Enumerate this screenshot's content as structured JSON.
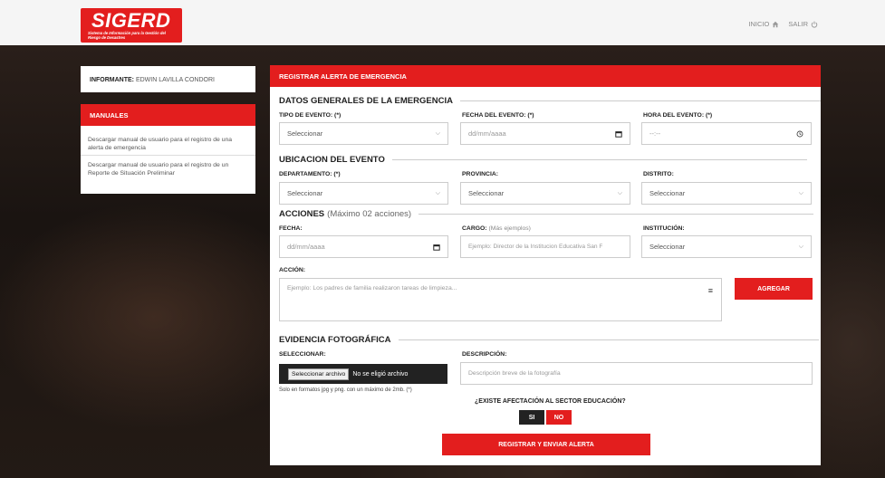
{
  "header": {
    "logo_text": "SIGERD",
    "logo_tagline": "Sistema de Información para la Gestión del Riesgo de Desastres",
    "nav": [
      {
        "label": "INICIO",
        "icon": "home-icon"
      },
      {
        "label": "SALIR",
        "icon": "power-icon"
      }
    ]
  },
  "sidebar": {
    "informante_label": "INFORMANTE:",
    "informante_name": "EDWIN LAVILLA CONDORI",
    "manuales_title": "MANUALES",
    "links": [
      "Descargar manual de usuario para el registro de una alerta de emergencia",
      "Descargar manual de usuario para el registro de un Reporte de Situación Preliminar"
    ]
  },
  "form": {
    "title": "REGISTRAR ALERTA DE EMERGENCIA",
    "section_general": "DATOS GENERALES DE LA EMERGENCIA",
    "tipo_label": "TIPO DE EVENTO: (*)",
    "tipo_value": "Seleccionar",
    "fecha_evento_label": "FECHA DEL EVENTO: (*)",
    "fecha_evento_placeholder": "dd/mm/aaaa",
    "hora_label": "HORA DEL EVENTO: (*)",
    "hora_placeholder": "--:--",
    "section_ubicacion": "UBICACION DEL EVENTO",
    "departamento_label": "DEPARTAMENTO: (*)",
    "departamento_value": "Seleccionar",
    "provincia_label": "PROVINCIA:",
    "provincia_value": "Seleccionar",
    "distrito_label": "DISTRITO:",
    "distrito_value": "Seleccionar",
    "section_acciones": "ACCIONES",
    "section_acciones_hint": "(Máximo 02 acciones)",
    "fecha_label": "FECHA:",
    "fecha_placeholder": "dd/mm/aaaa",
    "cargo_label": "CARGO:",
    "cargo_hint": "(Más ejemplos)",
    "cargo_placeholder": "Ejemplo: Director de la Institucion Educativa San F",
    "institucion_label": "INSTITUCIÓN:",
    "institucion_value": "Seleccionar",
    "accion_label": "ACCIÓN:",
    "accion_placeholder": "Ejemplo: Los padres de familia realizaron tareas de limpieza...",
    "agregar_button": "AGREGAR",
    "section_evidencia": "EVIDENCIA FOTOGRÁFICA",
    "seleccionar_label": "SELECCIONAR:",
    "file_button": "Seleccionar archivo",
    "file_status": "No se eligió archivo",
    "file_note": "Solo en formatos jpg y png. con un máximo de 2mb. (*)",
    "descripcion_label": "DESCRIPCIÓN:",
    "descripcion_placeholder": "Descripción breve de la fotografía",
    "question": "¿EXISTE AFECTACIÓN AL SECTOR EDUCACIÓN?",
    "yes_label": "SI",
    "no_label": "NO",
    "submit_button": "REGISTRAR Y ENVIAR ALERTA"
  },
  "colors": {
    "accent": "#e31e1e",
    "dark": "#222222"
  }
}
